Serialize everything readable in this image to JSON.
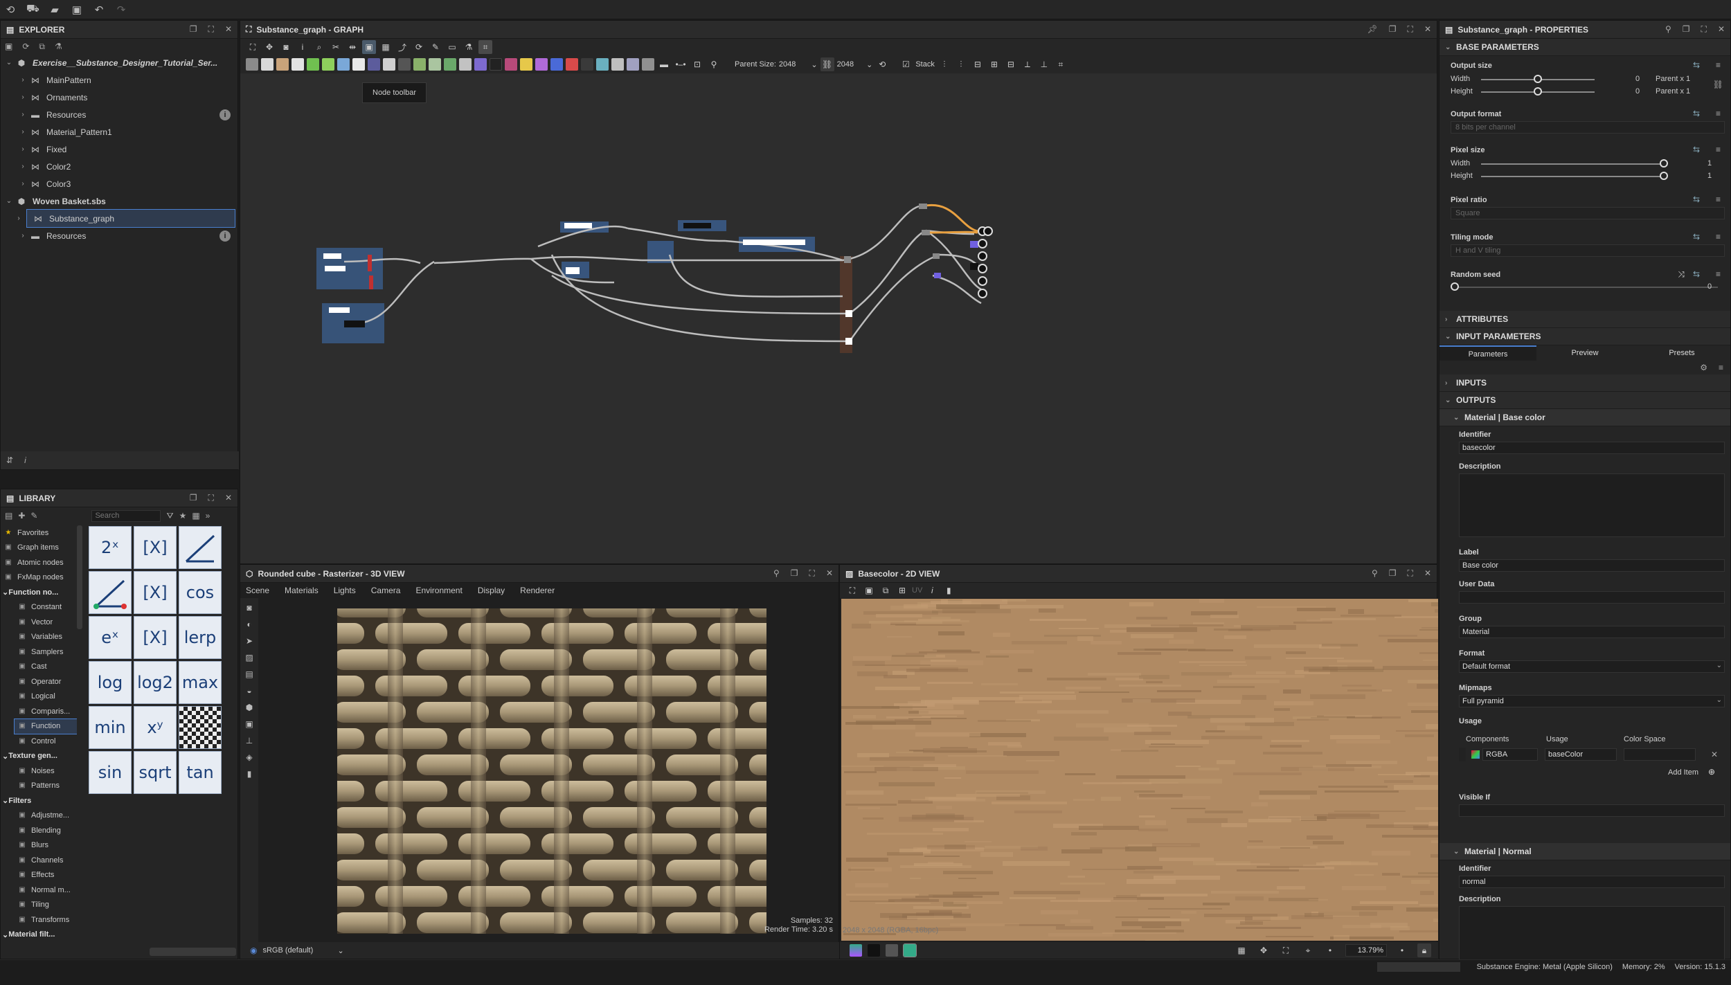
{
  "toolbar": {
    "icons": [
      "substance-logo-icon",
      "bag-icon",
      "folder-icon",
      "save-icon",
      "undo-icon",
      "redo-icon"
    ]
  },
  "explorer": {
    "title": "EXPLORER",
    "items": [
      {
        "label": "Exercise__Substance_Designer_Tutorial_Ser...",
        "level": 0,
        "kind": "package",
        "italic": true
      },
      {
        "label": "MainPattern",
        "level": 1,
        "kind": "graph"
      },
      {
        "label": "Ornaments",
        "level": 1,
        "kind": "graph"
      },
      {
        "label": "Resources",
        "level": 1,
        "kind": "folder",
        "info": true
      },
      {
        "label": "Material_Pattern1",
        "level": 1,
        "kind": "graph"
      },
      {
        "label": "Fixed",
        "level": 1,
        "kind": "graph"
      },
      {
        "label": "Color2",
        "level": 1,
        "kind": "graph"
      },
      {
        "label": "Color3",
        "level": 1,
        "kind": "graph"
      },
      {
        "label": "Woven Basket.sbs",
        "level": 0,
        "kind": "package"
      },
      {
        "label": "Substance_graph",
        "level": 1,
        "kind": "graph",
        "selected": true
      },
      {
        "label": "Resources",
        "level": 1,
        "kind": "folder",
        "info": true
      }
    ]
  },
  "library": {
    "title": "LIBRARY",
    "search_placeholder": "Search",
    "categories": [
      {
        "label": "Favorites",
        "head": false,
        "icon": "star"
      },
      {
        "label": "Graph items",
        "head": false
      },
      {
        "label": "Atomic nodes",
        "head": false
      },
      {
        "label": "FxMap nodes",
        "head": false
      },
      {
        "label": "Function no...",
        "head": true
      },
      {
        "label": "Constant",
        "head": false
      },
      {
        "label": "Vector",
        "head": false
      },
      {
        "label": "Variables",
        "head": false
      },
      {
        "label": "Samplers",
        "head": false
      },
      {
        "label": "Cast",
        "head": false
      },
      {
        "label": "Operator",
        "head": false
      },
      {
        "label": "Logical",
        "head": false
      },
      {
        "label": "Comparis...",
        "head": false
      },
      {
        "label": "Function",
        "head": false,
        "selected": true
      },
      {
        "label": "Control",
        "head": false
      },
      {
        "label": "Texture gen...",
        "head": true
      },
      {
        "label": "Noises",
        "head": false
      },
      {
        "label": "Patterns",
        "head": false
      },
      {
        "label": "Filters",
        "head": true
      },
      {
        "label": "Adjustme...",
        "head": false
      },
      {
        "label": "Blending",
        "head": false
      },
      {
        "label": "Blurs",
        "head": false
      },
      {
        "label": "Channels",
        "head": false
      },
      {
        "label": "Effects",
        "head": false
      },
      {
        "label": "Normal m...",
        "head": false
      },
      {
        "label": "Tiling",
        "head": false
      },
      {
        "label": "Transforms",
        "head": false
      },
      {
        "label": "Material filt...",
        "head": true
      }
    ],
    "tiles": [
      "2ˣ",
      "[X]",
      "slope",
      "slope-point",
      "[X]",
      "cos",
      "eˣ",
      "[X]",
      "lerp",
      "log",
      "log2",
      "max",
      "min",
      "xʸ",
      "noise",
      "sin",
      "sqrt",
      "tan"
    ]
  },
  "graph": {
    "title": "Substance_graph - GRAPH",
    "parent_size_label": "Parent Size:",
    "parent_size_value": "2048",
    "size_value": "2048",
    "stack_label": "Stack",
    "tooltip": "Node toolbar"
  },
  "properties": {
    "title": "Substance_graph - PROPERTIES",
    "base_parameters": "BASE PARAMETERS",
    "output_size": "Output size",
    "width_label": "Width",
    "height_label": "Height",
    "width_value": "0",
    "height_value": "0",
    "width_parent": "Parent x 1",
    "height_parent": "Parent x 1",
    "output_format": "Output format",
    "output_format_value": "8 bits per channel",
    "pixel_size": "Pixel size",
    "pixel_width_value": "1",
    "pixel_height_value": "1",
    "pixel_ratio": "Pixel ratio",
    "pixel_ratio_value": "Square",
    "tiling_mode": "Tiling mode",
    "tiling_mode_value": "H and V tiling",
    "random_seed": "Random seed",
    "random_seed_value": "0",
    "attributes": "ATTRIBUTES",
    "input_parameters": "INPUT PARAMETERS",
    "tabs": [
      "Parameters",
      "Preview",
      "Presets"
    ],
    "inputs": "INPUTS",
    "outputs": "OUTPUTS",
    "out1": {
      "title": "Material | Base color",
      "identifier_label": "Identifier",
      "identifier": "basecolor",
      "description_label": "Description",
      "label_label": "Label",
      "label": "Base color",
      "userdata_label": "User Data",
      "group_label": "Group",
      "group": "Material",
      "format_label": "Format",
      "format": "Default format",
      "mipmaps_label": "Mipmaps",
      "mipmaps": "Full pyramid",
      "usage_label": "Usage",
      "components_col": "Components",
      "usage_col": "Usage",
      "colorspace_col": "Color Space",
      "components": "RGBA",
      "usage": "baseColor",
      "add_item": "Add Item",
      "visible_if": "Visible If"
    },
    "out2": {
      "title": "Material | Normal",
      "identifier_label": "Identifier",
      "identifier": "normal",
      "description_label": "Description"
    }
  },
  "view3d": {
    "title": "Rounded cube - Rasterizer - 3D VIEW",
    "menu": [
      "Scene",
      "Materials",
      "Lights",
      "Camera",
      "Environment",
      "Display",
      "Renderer"
    ],
    "samples": "Samples: 32",
    "render_time": "Render Time: 3.20 s",
    "colorspace": "sRGB (default)"
  },
  "view2d": {
    "title": "Basecolor - 2D VIEW",
    "uv": "UV",
    "info": "2048 x 2048 (RGBA, 16bpc)",
    "zoom": "13.79%"
  },
  "status": {
    "engine": "Substance Engine: Metal (Apple Silicon)",
    "memory": "Memory: 2%",
    "version": "Version: 15.1.3"
  }
}
